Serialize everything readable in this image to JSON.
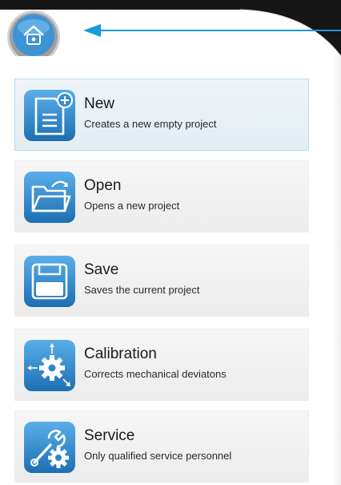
{
  "colors": {
    "dark_frame": "#1a1a1a",
    "arrow": "#1a9ad6",
    "icon_blue": "#2a86c7",
    "selected_border": "#b9dbea"
  },
  "home": {
    "icon": "home-icon"
  },
  "menu": {
    "items": [
      {
        "title": "New",
        "description": "Creates a new empty project",
        "icon": "new-document-icon",
        "selected": true
      },
      {
        "title": "Open",
        "description": "Opens a new project",
        "icon": "open-folder-icon",
        "selected": false
      },
      {
        "title": "Save",
        "description": "Saves the current project",
        "icon": "floppy-disk-icon",
        "selected": false
      },
      {
        "title": "Calibration",
        "description": "Corrects mechanical deviatons",
        "icon": "calibration-gear-icon",
        "selected": false
      },
      {
        "title": "Service",
        "description": "Only qualified service personnel",
        "icon": "service-tools-icon",
        "selected": false
      }
    ]
  }
}
